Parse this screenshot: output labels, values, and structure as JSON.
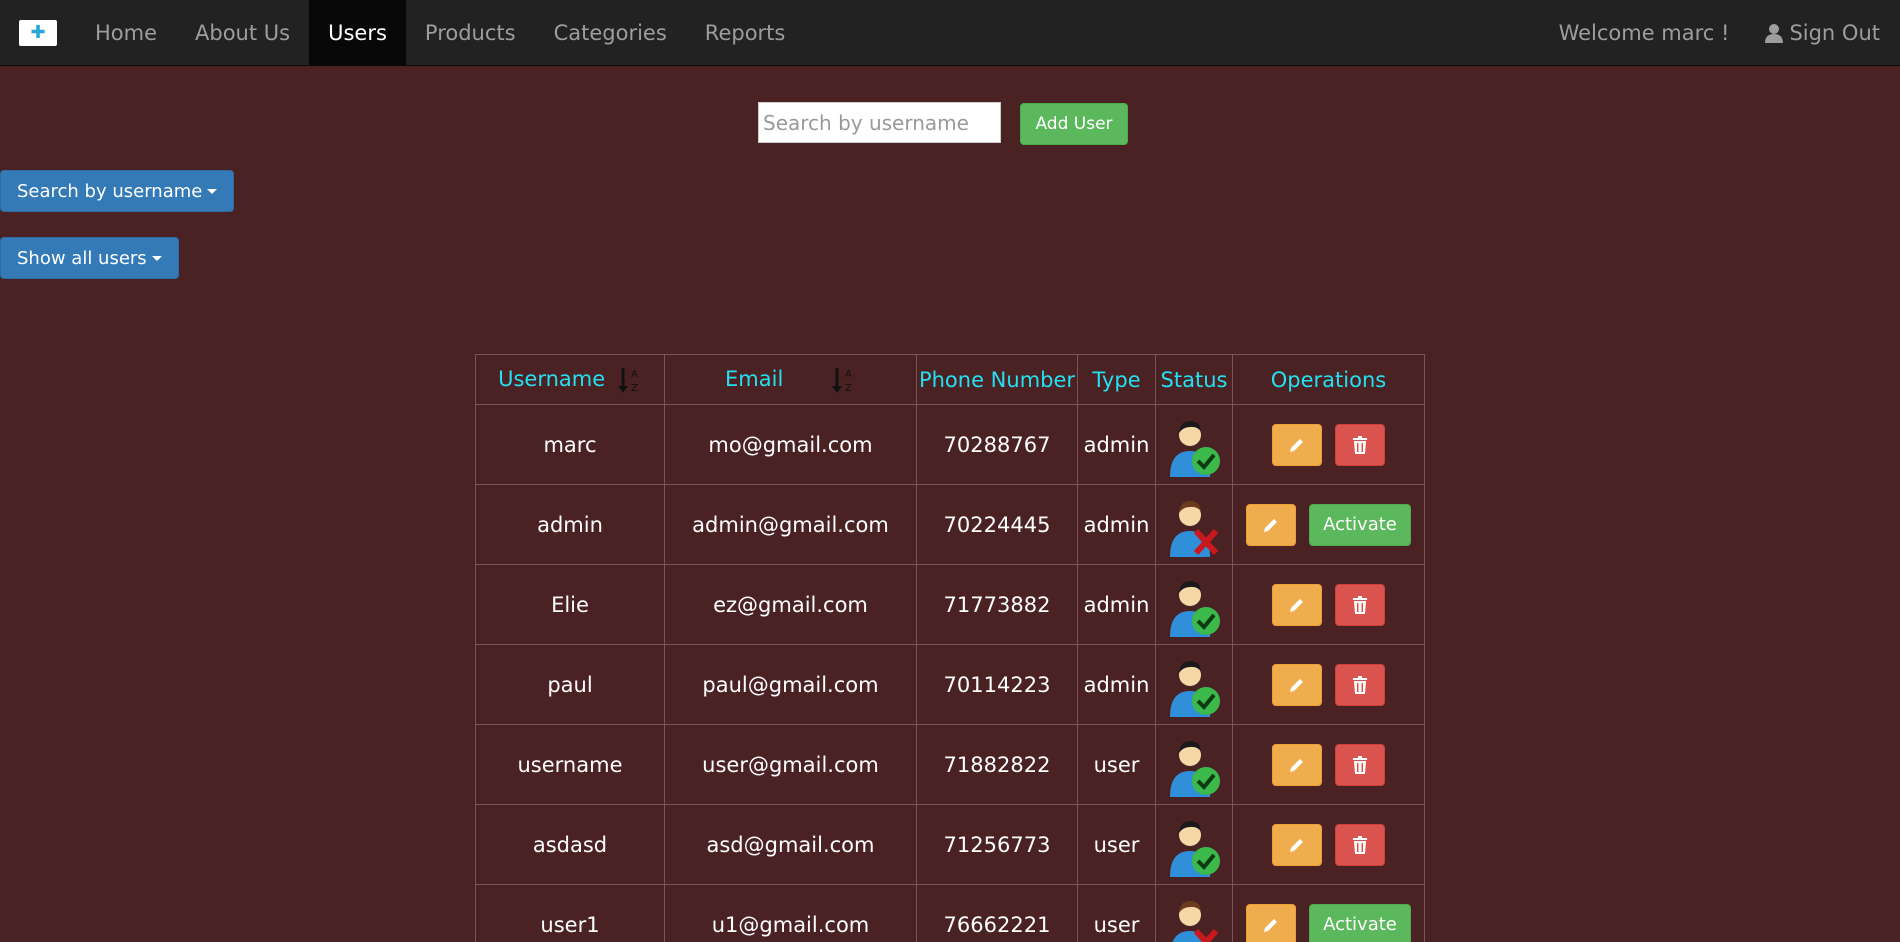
{
  "nav": {
    "items": [
      {
        "label": "Home",
        "active": false
      },
      {
        "label": "About Us",
        "active": false
      },
      {
        "label": "Users",
        "active": true
      },
      {
        "label": "Products",
        "active": false
      },
      {
        "label": "Categories",
        "active": false
      },
      {
        "label": "Reports",
        "active": false
      }
    ],
    "welcome": "Welcome marc !",
    "signout": "Sign Out"
  },
  "search": {
    "placeholder": "Search by username",
    "value": ""
  },
  "add_user_label": "Add User",
  "filter_search_label": "Search by username",
  "filter_users_label": "Show all users",
  "table": {
    "headers": {
      "username": "Username",
      "email": "Email",
      "phone": "Phone Number",
      "type": "Type",
      "status": "Status",
      "operations": "Operations"
    },
    "rows": [
      {
        "username": "marc",
        "email": "mo@gmail.com",
        "phone": "70288767",
        "type": "admin",
        "status": "active",
        "action": "Delete"
      },
      {
        "username": "admin",
        "email": "admin@gmail.com",
        "phone": "70224445",
        "type": "admin",
        "status": "inactive",
        "action": "Activate"
      },
      {
        "username": "Elie",
        "email": "ez@gmail.com",
        "phone": "71773882",
        "type": "admin",
        "status": "active",
        "action": "Delete"
      },
      {
        "username": "paul",
        "email": "paul@gmail.com",
        "phone": "70114223",
        "type": "admin",
        "status": "active",
        "action": "Delete"
      },
      {
        "username": "username",
        "email": "user@gmail.com",
        "phone": "71882822",
        "type": "user",
        "status": "active",
        "action": "Delete"
      },
      {
        "username": "asdasd",
        "email": "asd@gmail.com",
        "phone": "71256773",
        "type": "user",
        "status": "active",
        "action": "Delete"
      },
      {
        "username": "user1",
        "email": "u1@gmail.com",
        "phone": "76662221",
        "type": "user",
        "status": "inactive",
        "action": "Activate"
      }
    ]
  },
  "colors": {
    "background": "#4a2224",
    "header_text": "#24e0f0",
    "navbar": "#222222"
  }
}
